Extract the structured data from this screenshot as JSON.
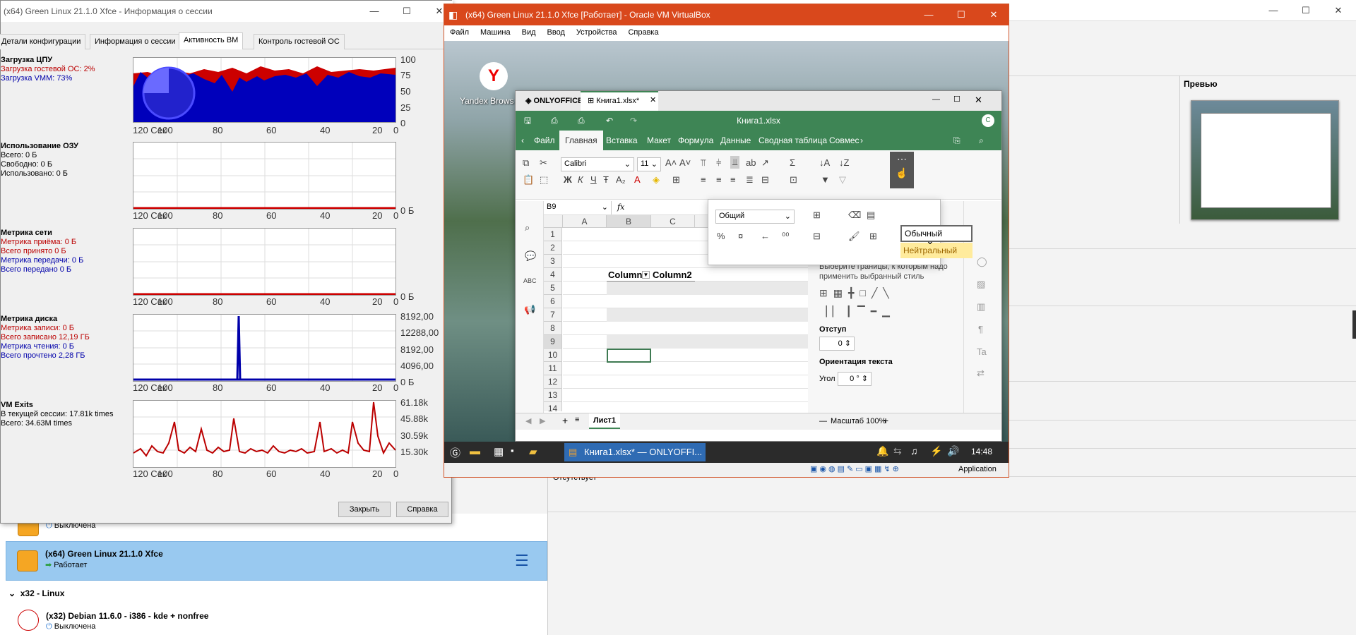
{
  "manager": {
    "preview_label": "Превью",
    "missing_text": "Отсутствует",
    "vms": [
      {
        "name": "",
        "state": "Выключена"
      },
      {
        "name": "(x64) Green Linux 21.1.0 Xfce",
        "state": "Работает"
      },
      {
        "name": "(x32) Debian 11.6.0 - i386 - kde + nonfree",
        "state": "Выключена"
      }
    ],
    "group_label": "x32 - Linux"
  },
  "session": {
    "title": "(x64) Green Linux 21.1.0 Xfce - Информация о сессии",
    "tabs": [
      "Детали конфигурации",
      "Информация о сессии",
      "Активность ВМ",
      "Контроль гостевой ОС"
    ],
    "active_tab": 2,
    "cpu": {
      "title": "Загрузка ЦПУ",
      "l1": "Загрузка гостевой ОС: 2%",
      "l2": "Загрузка VMM: 73%",
      "y": [
        "100",
        "75",
        "50",
        "25",
        "0"
      ]
    },
    "ram": {
      "title": "Использование ОЗУ",
      "l1": "Всего: 0 Б",
      "l2": "Свободно: 0 Б",
      "l3": "Использовано: 0 Б",
      "y0": "0 Б"
    },
    "net": {
      "title": "Метрика сети",
      "l1": "Метрика приёма: 0 Б",
      "l2": "Всего принято 0 Б",
      "l3": "Метрика передачи: 0 Б",
      "l4": "Всего передано 0 Б",
      "y0": "0 Б"
    },
    "disk": {
      "title": "Метрика диска",
      "l1": "Метрика записи: 0 Б",
      "l2": "Всего записано 12,19 ГБ",
      "l3": "Метрика чтения: 0 Б",
      "l4": "Всего прочтено 2,28 ГБ",
      "y": [
        "8192,00",
        "12288,00",
        "8192,00",
        "4096,00",
        "0 Б"
      ]
    },
    "exits": {
      "title": "VM Exits",
      "l1": "В текущей сессии: 17.81k times",
      "l2": "Всего: 34.63M times",
      "y": [
        "61.18k",
        "45.88k",
        "30.59k",
        "15.30k"
      ]
    },
    "x_axis": [
      "120 Сек",
      "100",
      "80",
      "60",
      "40",
      "20",
      "0"
    ],
    "close_btn": "Закрыть",
    "help_btn": "Справка"
  },
  "vbox": {
    "title": "(x64) Green Linux 21.1.0 Xfce [Работает] - Oracle VM VirtualBox",
    "menu": [
      "Файл",
      "Машина",
      "Вид",
      "Ввод",
      "Устройства",
      "Справка"
    ],
    "desktop_icon": "Yandex Brows",
    "status_app": "Application",
    "taskbar_task": "Книга1.xlsx* — ONLYOFFI...",
    "clock": "14:48"
  },
  "oo": {
    "brand": "ONLYOFFICE",
    "doc_tab": "Книга1.xlsx*",
    "doc_title": "Книга1.xlsx",
    "user_initial": "С",
    "tabs": [
      "Файл",
      "Главная",
      "Вставка",
      "Макет",
      "Формула",
      "Данные",
      "Сводная таблица",
      "Совмес"
    ],
    "active_tab": 1,
    "font": "Calibri",
    "size": "11",
    "cell_ref": "B9",
    "fx": "fx",
    "cols": [
      "A",
      "B",
      "C"
    ],
    "rows": [
      "1",
      "2",
      "3",
      "4",
      "5",
      "6",
      "7",
      "8",
      "9",
      "10",
      "11",
      "12",
      "13",
      "14"
    ],
    "header1": "Column1",
    "header2": "Column2",
    "number_format": "Общий",
    "style_normal": "Обычный",
    "style_neutral": "Нейтральный",
    "panel_hint": "Выберите границы, к которым надо применить выбранный стиль",
    "indent_label": "Отступ",
    "indent_value": "0",
    "orient_label": "Ориентация текста",
    "angle_label": "Угол",
    "angle_value": "0 °",
    "sheet": "Лист1",
    "zoom": "Масштаб 100%"
  }
}
